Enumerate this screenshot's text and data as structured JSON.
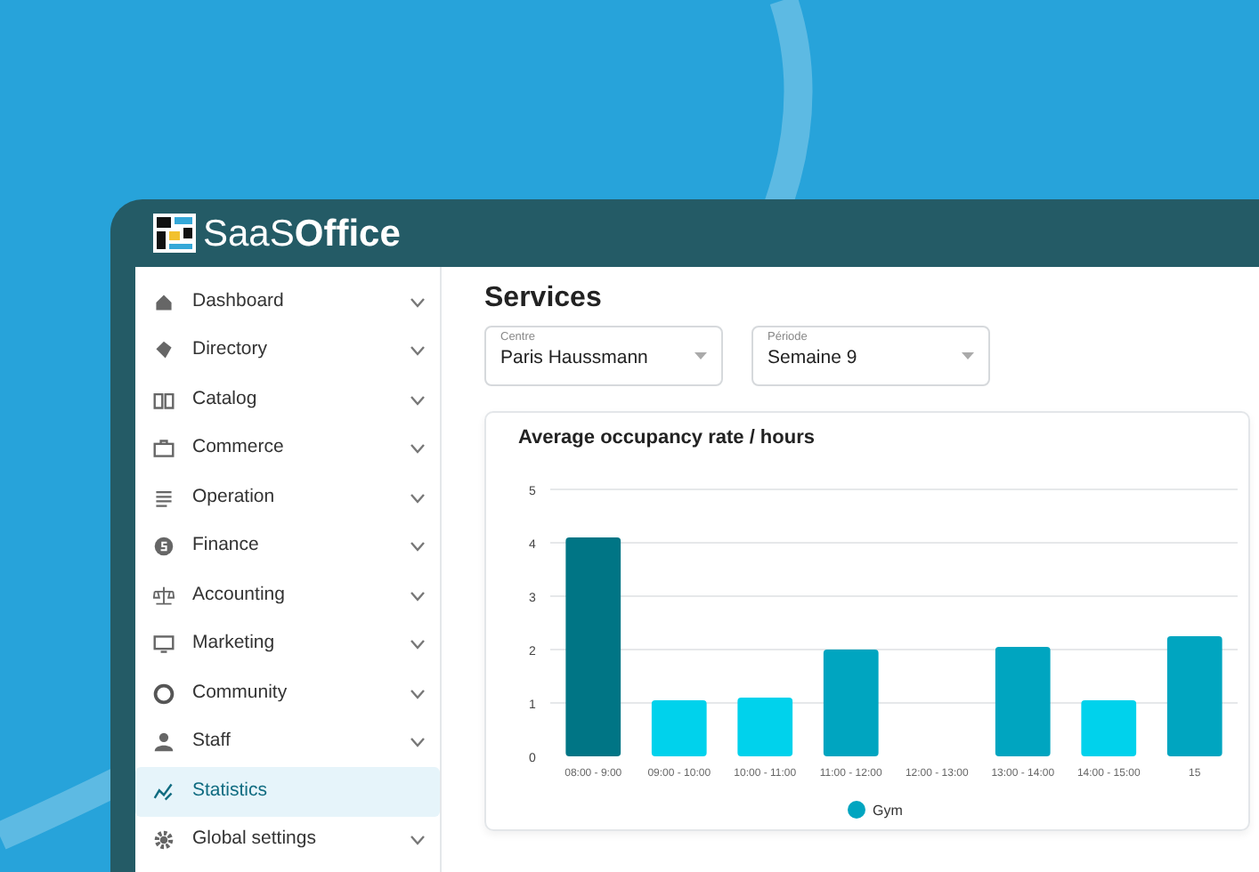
{
  "app": {
    "logo": "SaaS**Office**"
  },
  "sidebar": {
    "items": [
      {
        "label": "Dashboard",
        "selected": false,
        "expandable": true
      },
      {
        "label": "Directory",
        "selected": false,
        "expandable": true
      },
      {
        "label": "Catalog",
        "selected": false,
        "expandable": true
      },
      {
        "label": "Commerce",
        "selected": false,
        "expandable": true
      },
      {
        "label": "Operation",
        "selected": false,
        "expandable": true
      },
      {
        "label": "Finance",
        "selected": false,
        "expandable": true
      },
      {
        "label": "Accounting",
        "selected": false,
        "expandable": true
      },
      {
        "label": "Marketing",
        "selected": false,
        "expandable": true
      },
      {
        "label": "Community",
        "selected": false,
        "expandable": true
      },
      {
        "label": "Staff",
        "selected": false,
        "expandable": true
      },
      {
        "label": "Statistics",
        "selected": true,
        "expandable": false
      },
      {
        "label": "Global settings",
        "selected": false,
        "expandable": true
      }
    ]
  },
  "page": {
    "title": "Services",
    "filters": [
      {
        "label": "Centre",
        "value": "Paris Haussmann"
      },
      {
        "label": "Période",
        "value": "Semaine 9"
      }
    ],
    "chart_card": {
      "title": "Average occupancy rate / hours",
      "chart_data": {
        "type": "bar",
        "categories": [
          "08:00 - 9:00",
          "09:00 - 10:00",
          "10:00 - 11:00",
          "11:00 - 12:00",
          "12:00 - 13:00",
          "13:00 - 14:00",
          "14:00 - 15:00",
          "15"
        ],
        "series": [
          {
            "name": "Gym",
            "color": "#00a5c0",
            "values": [
              4.1,
              1.05,
              1.1,
              2.0,
              0,
              2.05,
              1.05,
              2.25
            ],
            "colors": [
              "#007585",
              "#00d2ec",
              "#00d2ec",
              "#00a5c0",
              "#00a5c0",
              "#00a5c0",
              "#00d2ec",
              "#00a5c0"
            ]
          }
        ],
        "ylim": [
          0,
          5
        ],
        "yticks": [
          0,
          1,
          2,
          3,
          4,
          5
        ],
        "grid": true
      }
    }
  }
}
